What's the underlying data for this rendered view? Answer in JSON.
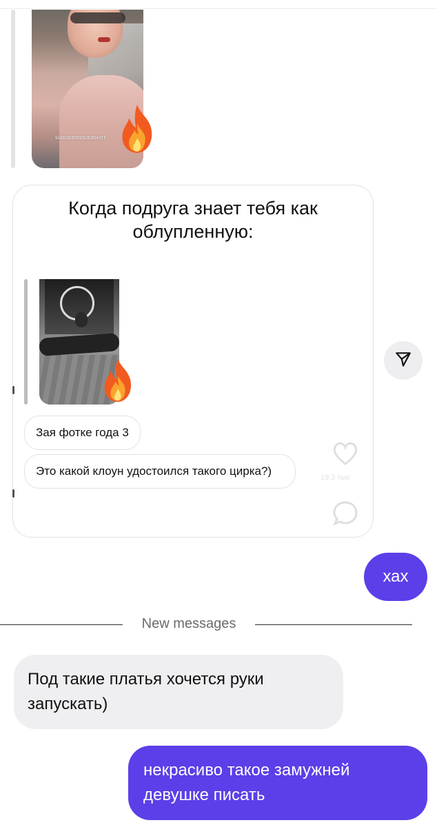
{
  "top_post": {
    "photo_caption": "summmmmmmerrr"
  },
  "shared_post": {
    "title_line1": "Когда подруга знает тебя как",
    "title_line2": "облупленную:",
    "comments": [
      {
        "text": "Зая фотке года 3"
      },
      {
        "text": "Это какой клоун удостоился такого цирка?)"
      }
    ],
    "ghost_like_count": "19,3 тыс"
  },
  "messages": [
    {
      "direction": "outgoing",
      "text": "хах"
    },
    {
      "direction": "incoming",
      "text": "Под такие платья хочется руки запускать)"
    },
    {
      "direction": "outgoing",
      "text": "некрасиво такое замужней девушке писать"
    }
  ],
  "divider": {
    "label": "New messages"
  },
  "colors": {
    "outgoing_bubble": "#5c3fe8",
    "incoming_bubble": "#efeff1",
    "share_button_bg": "#eeeef1"
  },
  "icons": {
    "share": "paper-plane-icon",
    "fire": "fire-emoji-icon",
    "like": "heart-icon",
    "comment": "comment-bubble-icon"
  }
}
